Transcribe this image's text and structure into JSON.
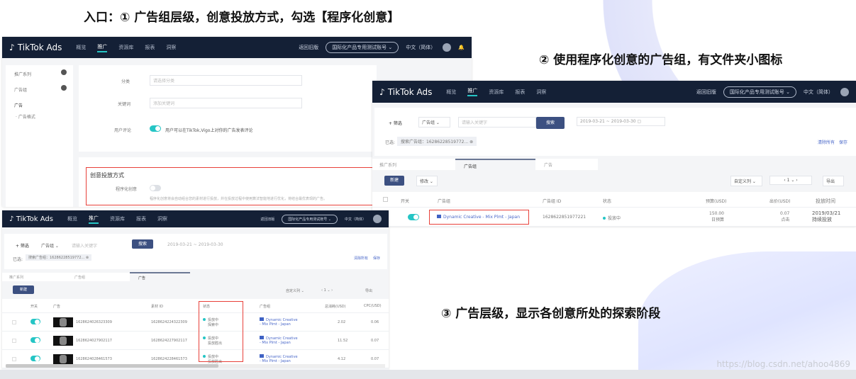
{
  "captions": {
    "c1": "入口：① 广告组层级，创意投放方式，勾选【程序化创意】",
    "c2": "② 使用程序化创意的广告组，有文件夹小图标",
    "c3": "③ 广告层级，显示各创意所处的探索阶段"
  },
  "header": {
    "logo": "TikTok",
    "logo2": " Ads",
    "nav": [
      "概览",
      "推广",
      "资源库",
      "报表",
      "洞察"
    ],
    "back": "返回旧版",
    "account": "国际化产品专用测试账号 ⌄",
    "lang": "中文（简体）"
  },
  "p1": {
    "sidebar": [
      "推广系列",
      "广告组",
      "广告",
      "· 广告格式"
    ],
    "category_label": "分类",
    "category_ph": "请选择分类",
    "keyword_label": "关键词",
    "keyword_ph": "添加关键词",
    "comment_label": "用户评论",
    "comment_text": "用户可以在TikTok,Vigo上对你的广告发表评论",
    "section_title": "创意投放方式",
    "prog_label": "程序化创意",
    "prog_desc": "程序化创意将会自动组合您的素材进行投放，并在投放过程中使用算法智能地进行优化，将结合最优表现的广告。"
  },
  "filter": {
    "add": "+ 筛选",
    "scope": "广告组 ⌄",
    "search_ph": "请输入关键字",
    "search_btn": "搜索",
    "date_from": "2019-03-21",
    "date_sep": "~",
    "date_to": "2019-03-30",
    "selected": "已选:",
    "tag": "搜索广告组：16286228519772...",
    "clear": "清除所有",
    "save": "保存"
  },
  "tabs": [
    "推广系列",
    "广告组",
    "广告"
  ],
  "toolbar": {
    "new": "新建",
    "edit": "修改 ⌄",
    "custom": "自定义列 ⌄",
    "page": "1 ⌄",
    "export": "导出"
  },
  "p2": {
    "cols": [
      "开关",
      "广告组",
      "广告组 ID",
      "状态",
      "预算(USD)",
      "出价(USD)",
      "投放时间"
    ],
    "row": {
      "name": "Dynamic Creative - Mix Plmt - Japan",
      "id": "1628622851977221",
      "status": "投放中",
      "budget": "150.00",
      "budget_sub": "日预算",
      "bid": "0.07",
      "bid_sub": "点击",
      "time": "2019/03/21",
      "time_sub": "持续投放"
    }
  },
  "p3": {
    "cols": [
      "开关",
      "广告",
      "素材 ID",
      "状态",
      "广告组",
      "总消耗(USD)",
      "CPC(USD)"
    ],
    "rows": [
      {
        "ad": "1628624026323309",
        "id": "1628624224322309",
        "status": "投放中",
        "phase": "探索中",
        "group": "Dynamic Creative - Mix Plmt - Japan",
        "spend": "2.02",
        "cpc": "0.06"
      },
      {
        "ad": "1628624027902117",
        "id": "1628624227902117",
        "status": "投放中",
        "phase": "投放胜出",
        "group": "Dynamic Creative - Mix Plmt - Japan",
        "spend": "11.52",
        "cpc": "0.07"
      },
      {
        "ad": "1628624028461573",
        "id": "1628624228461573",
        "status": "投放中",
        "phase": "投放胜出",
        "group": "Dynamic Creative - Mix Plmt - Japan",
        "spend": "4.12",
        "cpc": "0.07"
      }
    ]
  },
  "watermark": "https://blog.csdn.net/ahoo4869"
}
